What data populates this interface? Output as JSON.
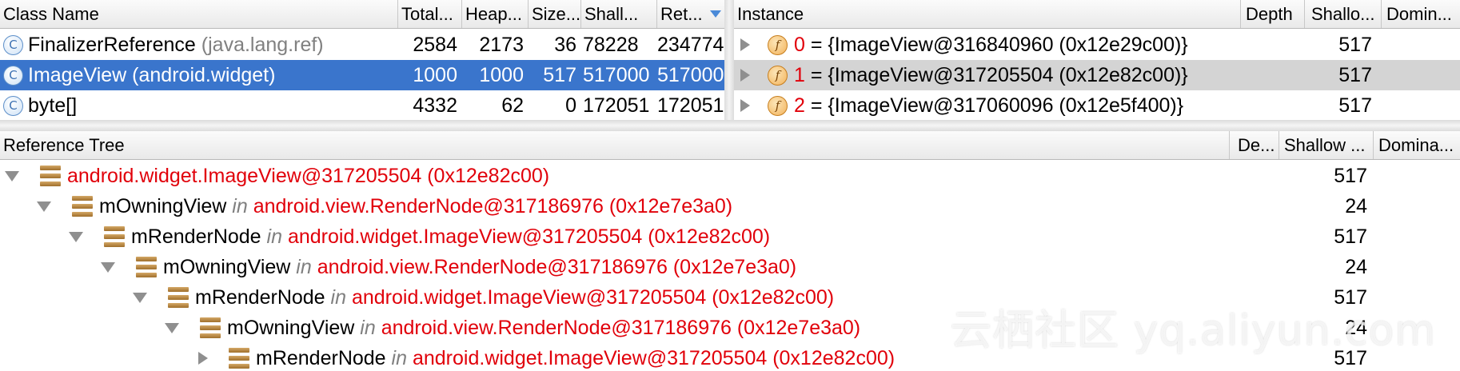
{
  "class_panel": {
    "columns": [
      "Class Name",
      "Total...",
      "Heap...",
      "Size...",
      "Shall...",
      "Ret..."
    ],
    "rows": [
      {
        "icon": "C",
        "name": "FinalizerReference",
        "pkg": "(java.lang.ref)",
        "total": "2584",
        "heap": "2173",
        "size": "36",
        "shallow": "78228",
        "retained": "234774"
      },
      {
        "icon": "C",
        "name": "ImageView",
        "pkg": "(android.widget)",
        "total": "1000",
        "heap": "1000",
        "size": "517",
        "shallow": "517000",
        "retained": "517000"
      },
      {
        "icon": "C",
        "name": "byte[]",
        "pkg": "",
        "total": "4332",
        "heap": "62",
        "size": "0",
        "shallow": "172051",
        "retained": "172051"
      }
    ]
  },
  "instance_panel": {
    "columns": [
      "Instance",
      "Depth",
      "Shallo...",
      "Domin..."
    ],
    "rows": [
      {
        "icon": "f",
        "index": "0",
        "value": "= {ImageView@316840960 (0x12e29c00)}",
        "depth": "",
        "shallow": "517",
        "dominating": ""
      },
      {
        "icon": "f",
        "index": "1",
        "value": "= {ImageView@317205504 (0x12e82c00)}",
        "depth": "",
        "shallow": "517",
        "dominating": ""
      },
      {
        "icon": "f",
        "index": "2",
        "value": "= {ImageView@317060096 (0x12e5f400)}",
        "depth": "",
        "shallow": "517",
        "dominating": ""
      }
    ]
  },
  "reference_tree": {
    "columns": [
      "Reference Tree",
      "De...",
      "Shallow ...",
      "Domina..."
    ],
    "in_word": "in",
    "rows": [
      {
        "field": "",
        "target": "android.widget.ImageView@317205504 (0x12e82c00)",
        "shallow": "517"
      },
      {
        "field": "mOwningView",
        "target": "android.view.RenderNode@317186976 (0x12e7e3a0)",
        "shallow": "24"
      },
      {
        "field": "mRenderNode",
        "target": "android.widget.ImageView@317205504 (0x12e82c00)",
        "shallow": "517"
      },
      {
        "field": "mOwningView",
        "target": "android.view.RenderNode@317186976 (0x12e7e3a0)",
        "shallow": "24"
      },
      {
        "field": "mRenderNode",
        "target": "android.widget.ImageView@317205504 (0x12e82c00)",
        "shallow": "517"
      },
      {
        "field": "mOwningView",
        "target": "android.view.RenderNode@317186976 (0x12e7e3a0)",
        "shallow": "24"
      },
      {
        "field": "mRenderNode",
        "target": "android.widget.ImageView@317205504 (0x12e82c00)",
        "shallow": "517"
      }
    ]
  },
  "watermark": "云栖社区 yq.aliyun.com",
  "colors": {
    "selection": "#3a75cc",
    "reference_red": "#e1000a",
    "package_gray": "#808080"
  }
}
